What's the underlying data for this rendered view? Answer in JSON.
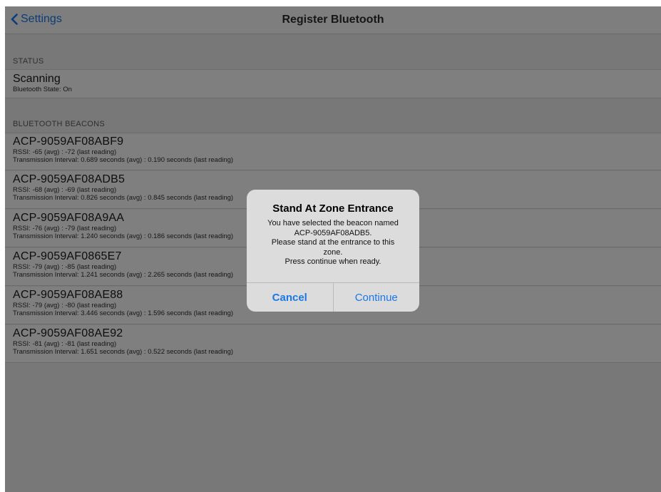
{
  "navbar": {
    "back_label": "Settings",
    "title": "Register Bluetooth"
  },
  "status_section": {
    "header": "STATUS",
    "title": "Scanning",
    "subtitle": "Bluetooth State: On"
  },
  "beacons_section": {
    "header": "BLUETOOTH BEACONS",
    "items": [
      {
        "name": "ACP-9059AF08ABF9",
        "rssi": "RSSI: -65 (avg) : -72 (last reading)",
        "interval": "Transmission Interval: 0.689 seconds (avg) : 0.190 seconds (last reading)"
      },
      {
        "name": "ACP-9059AF08ADB5",
        "rssi": "RSSI: -68 (avg) : -69 (last reading)",
        "interval": "Transmission Interval: 0.826 seconds (avg) : 0.845 seconds (last reading)"
      },
      {
        "name": "ACP-9059AF08A9AA",
        "rssi": "RSSI: -76 (avg) : -79 (last reading)",
        "interval": "Transmission Interval: 1.240 seconds (avg) : 0.186 seconds (last reading)"
      },
      {
        "name": "ACP-9059AF0865E7",
        "rssi": "RSSI: -79 (avg) : -85 (last reading)",
        "interval": "Transmission Interval: 1.241 seconds (avg) : 2.265 seconds (last reading)"
      },
      {
        "name": "ACP-9059AF08AE88",
        "rssi": "RSSI: -79 (avg) : -80 (last reading)",
        "interval": "Transmission Interval: 3.446 seconds (avg) : 1.596 seconds (last reading)"
      },
      {
        "name": "ACP-9059AF08AE92",
        "rssi": "RSSI: -81 (avg) : -81 (last reading)",
        "interval": "Transmission Interval: 1.651 seconds (avg) : 0.522 seconds (last reading)"
      }
    ]
  },
  "alert": {
    "title": "Stand At Zone Entrance",
    "message": "You have selected the beacon named\nACP-9059AF08ADB5.\nPlease stand at the entrance to this\nzone.\nPress continue when ready.",
    "cancel_label": "Cancel",
    "continue_label": "Continue"
  },
  "colors": {
    "accent": "#1a78e6",
    "dimmed_background": "#787878"
  },
  "icons": {
    "back": "chevron-left-icon"
  }
}
